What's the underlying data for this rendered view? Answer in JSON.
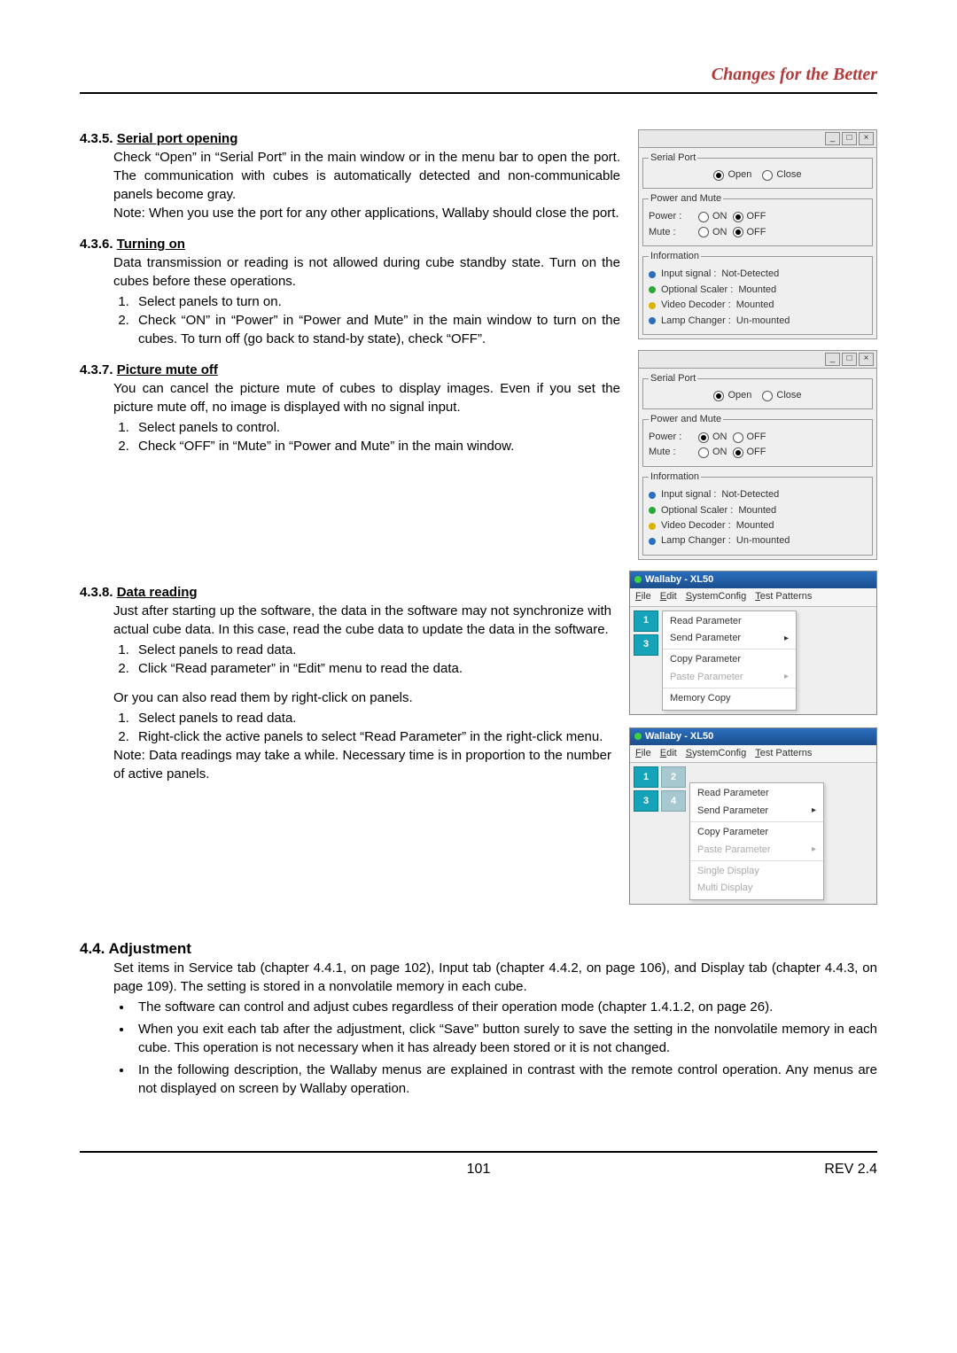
{
  "header": {
    "slogan": "Changes for the Better"
  },
  "s435": {
    "num": "4.3.5.",
    "title": "Serial port opening",
    "p1": "Check “Open” in “Serial Port” in the main window or in the menu bar to open the port. The communication with cubes is automatically detected and non-communicable panels become gray.",
    "p2": "Note: When you use the port for any other applications, Wallaby should close the port."
  },
  "s436": {
    "num": "4.3.6.",
    "title": "Turning on",
    "p1": "Data transmission or reading is not allowed during cube standby state. Turn on the cubes before these operations.",
    "li1": "Select panels to turn on.",
    "li2": "Check “ON” in “Power” in “Power and Mute” in the main window to turn on the cubes. To turn off (go back to stand-by state), check “OFF”."
  },
  "s437": {
    "num": "4.3.7.",
    "title": "Picture mute off",
    "p1": "You can cancel the picture mute of cubes to display images. Even if you set the picture mute off, no image is displayed with no signal input.",
    "li1": "Select panels to control.",
    "li2": "Check “OFF” in “Mute” in “Power and Mute” in the main window."
  },
  "s438": {
    "num": "4.3.8.",
    "title": "Data reading",
    "p1": "Just after starting up the software, the data in the software may not synchronize with actual cube data. In this case, read the cube data to update the data in the software.",
    "li1": "Select panels to read data.",
    "li2": "Click “Read parameter” in “Edit” menu to read the data.",
    "p2": "Or you can also read them by right-click on panels.",
    "lib1": "Select panels to read data.",
    "lib2": "Right-click the active panels to select “Read Parameter” in the right-click menu.",
    "p3": "Note: Data readings may take a while. Necessary time is in proportion to the number of active panels."
  },
  "s44": {
    "num": "4.4.",
    "title": "Adjustment",
    "p1": "Set items in Service tab (chapter 4.4.1, on page 102), Input tab (chapter 4.4.2, on page 106), and Display tab (chapter 4.4.3, on page 109). The setting is stored in a nonvolatile memory in each cube.",
    "b1": "The software can control and adjust cubes regardless of their operation mode (chapter 1.4.1.2, on page 26).",
    "b2": "When you exit each tab after the adjustment, click “Save” button surely to save the setting in the nonvolatile memory in each cube. This operation is not necessary when it has already been stored or it is not changed.",
    "b3": "In the following description, the Wallaby menus are explained in contrast with the remote control operation. Any menus are not displayed on screen by Wallaby operation."
  },
  "panels": {
    "serial_legend": "Serial Port",
    "open": "Open",
    "close": "Close",
    "pm_legend": "Power and Mute",
    "power": "Power :",
    "mute": "Mute :",
    "on": "ON",
    "off": "OFF",
    "info_legend": "Information",
    "i_input": "Input signal :",
    "i_input_v": "Not-Detected",
    "i_os": "Optional Scaler :",
    "i_os_v": "Mounted",
    "i_vd": "Video Decoder :",
    "i_vd_v": "Mounted",
    "i_lc": "Lamp Changer :",
    "i_lc_v": "Un-mounted"
  },
  "app": {
    "title": "Wallaby - XL50",
    "menus": {
      "file": "File",
      "edit": "Edit",
      "syscfg": "SystemConfig",
      "test": "Test Patterns"
    },
    "menu1": {
      "read": "Read Parameter",
      "send": "Send Parameter",
      "copy": "Copy Parameter",
      "paste": "Paste Parameter",
      "mem": "Memory Copy"
    },
    "menu2": {
      "read": "Read Parameter",
      "send": "Send Parameter",
      "copy": "Copy Parameter",
      "paste": "Paste Parameter",
      "single": "Single Display",
      "multi": "Multi Display"
    },
    "cells": {
      "c1": "1",
      "c2": "2",
      "c3": "3",
      "c4": "4"
    }
  },
  "footer": {
    "page": "101",
    "rev": "REV 2.4"
  }
}
